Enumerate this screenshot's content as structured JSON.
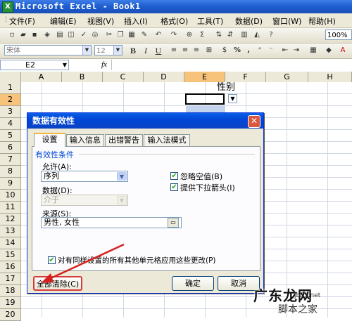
{
  "app": {
    "title": "Microsoft Excel - Book1",
    "icon": "excel-app-icon"
  },
  "menu": [
    "文件(F)",
    "编辑(E)",
    "视图(V)",
    "插入(I)",
    "格式(O)",
    "工具(T)",
    "数据(D)",
    "窗口(W)",
    "帮助(H)"
  ],
  "toolbar": {
    "zoom": "100%",
    "font_name": "宋体",
    "font_size": "12",
    "bold": "B",
    "italic": "I",
    "underline": "U",
    "percent": "%",
    "comma": ",",
    "sigma": "Σ",
    "currency": "$"
  },
  "formula_bar": {
    "cell_ref": "E2",
    "fx": "fx"
  },
  "columns": [
    "A",
    "B",
    "C",
    "D",
    "E",
    "F",
    "G",
    "H"
  ],
  "rows": [
    "1",
    "2",
    "3",
    "4",
    "5",
    "6",
    "7",
    "8",
    "9",
    "10",
    "11",
    "12",
    "13",
    "14",
    "15",
    "16",
    "17",
    "18",
    "19",
    "20"
  ],
  "cells": {
    "E1": "性别"
  },
  "dialog": {
    "title": "数据有效性",
    "tabs": [
      "设置",
      "输入信息",
      "出错警告",
      "输入法模式"
    ],
    "active_tab": "设置",
    "group_label": "有效性条件",
    "allow_label": "允许(A):",
    "allow_value": "序列",
    "data_label": "数据(D):",
    "data_value": "介于",
    "ignore_blank": {
      "label": "忽略空值(B)",
      "checked": true
    },
    "dropdown_arrow": {
      "label": "提供下拉箭头(I)",
      "checked": true
    },
    "source_label": "来源(S):",
    "source_value": "男性, 女性",
    "apply_all": {
      "label": "对有同样设置的所有其他单元格应用这些更改(P)",
      "checked": true
    },
    "clear_all": "全部清除(C)",
    "ok": "确定",
    "cancel": "取消"
  },
  "watermark": {
    "main": "广东龙网",
    "sub": "脚本之家",
    "url": "jb51.net"
  }
}
